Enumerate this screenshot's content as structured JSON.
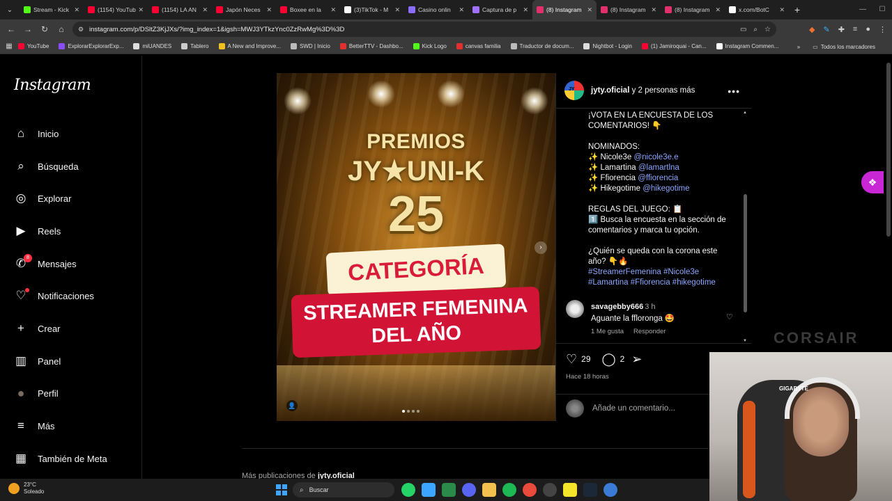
{
  "browser": {
    "tabs": [
      {
        "label": "Stream - Kick",
        "color": "#53fc18",
        "active": false
      },
      {
        "label": "(1154) YouTube",
        "color": "#ff0033",
        "active": false
      },
      {
        "label": "(1154) LA AN",
        "color": "#ff0033",
        "active": false
      },
      {
        "label": "Japón Neces",
        "color": "#ff0033",
        "active": false
      },
      {
        "label": "Boxee en la",
        "color": "#ff0033",
        "active": false
      },
      {
        "label": "(3)TikTok - M",
        "color": "#ffffff",
        "active": false
      },
      {
        "label": "Casino onlin",
        "color": "#8a6cff",
        "active": false
      },
      {
        "label": "Captura de p",
        "color": "#a070ff",
        "active": false
      },
      {
        "label": "(8) Instagram",
        "color": "#e1306c",
        "active": true
      },
      {
        "label": "(8) Instagram",
        "color": "#e1306c",
        "active": false
      },
      {
        "label": "(8) Instagram",
        "color": "#e1306c",
        "active": false
      },
      {
        "label": "x.com/BotC",
        "color": "#ffffff",
        "active": false
      }
    ],
    "url": "instagram.com/p/DSltZ3KjJXs/?img_index=1&igsh=MWJ3YTkzYnc0ZzRwMg%3D%3D",
    "bookmarks": [
      {
        "label": "YouTube",
        "color": "#ff0033"
      },
      {
        "label": "ExplorarExplorarExp...",
        "color": "#8a4cff"
      },
      {
        "label": "miUANDES",
        "color": "#dddddd"
      },
      {
        "label": "Tablero",
        "color": "#cccccc"
      },
      {
        "label": "A New and Improve...",
        "color": "#f0c020"
      },
      {
        "label": "SWD | Inicio",
        "color": "#bbbbbb"
      },
      {
        "label": "BetterTTV - Dashbo...",
        "color": "#e03030"
      },
      {
        "label": "Kick Logo",
        "color": "#53fc18"
      },
      {
        "label": "canvas familia",
        "color": "#e03030"
      },
      {
        "label": "Traductor de docum...",
        "color": "#bbbbbb"
      },
      {
        "label": "Nightbot - Login",
        "color": "#dddddd"
      },
      {
        "label": "(1) Jamiroquai - Can...",
        "color": "#ff0033"
      },
      {
        "label": "Instagram Commen...",
        "color": "#ffffff"
      }
    ],
    "all_bookmarks": "Todos los marcadores"
  },
  "instagram": {
    "logo": "Instagram",
    "nav": [
      {
        "label": "Inicio",
        "icon": "home-icon"
      },
      {
        "label": "Búsqueda",
        "icon": "search-icon"
      },
      {
        "label": "Explorar",
        "icon": "compass-icon"
      },
      {
        "label": "Reels",
        "icon": "reels-icon"
      },
      {
        "label": "Mensajes",
        "icon": "messenger-icon",
        "badge": "8"
      },
      {
        "label": "Notificaciones",
        "icon": "heart-icon"
      },
      {
        "label": "Crear",
        "icon": "plus-icon"
      },
      {
        "label": "Panel",
        "icon": "chart-icon"
      },
      {
        "label": "Perfil",
        "icon": "profile-avatar"
      },
      {
        "label": "Más",
        "icon": "menu-icon"
      },
      {
        "label": "También de Meta",
        "icon": "meta-icon"
      }
    ],
    "post": {
      "image_text": {
        "line1": "PREMIOS",
        "line2": "JY★UNI-K",
        "line3": "25",
        "category": "CATEGORÍA",
        "award_line1": "STREAMER FEMENINA",
        "award_line2": "DEL AÑO"
      },
      "author": "jyty.oficial",
      "author_suffix": " y 2 personas más",
      "avatar_text": "JY",
      "caption": {
        "p1": "¡VOTA EN LA ENCUESTA DE LOS COMENTARIOS! 👇",
        "nominados_title": "NOMINADOS:",
        "nominees": [
          {
            "name": "✨ Nicole3e ",
            "handle": "@nicole3e.e"
          },
          {
            "name": "✨ Lamartina ",
            "handle": "@lamartlna"
          },
          {
            "name": "✨ Ffiorencia ",
            "handle": "@ffiorencia"
          },
          {
            "name": "✨ Hikegotime ",
            "handle": "@hikegotime"
          }
        ],
        "rules_title": "REGLAS DEL JUEGO: 📋",
        "rules": "1️⃣ Busca la encuesta en la sección de comentarios y marca tu opción.",
        "question": "¿Quién se queda con la corona este año? 👇🔥",
        "hashtags": "#StreamerFemenina #Nicole3e #Lamartina #Ffiorencia #hikegotime"
      },
      "comment": {
        "user": "savagebby666",
        "time": "3 h",
        "text": "Aguante la fflorongа 🤩",
        "likes": "1 Me gusta",
        "reply": "Responder"
      },
      "likes": "29",
      "comments_count": "2",
      "posted": "Hace 18 horas",
      "add_comment_placeholder": "Añade un comentario..."
    },
    "more_posts_prefix": "Más publicaciones de ",
    "more_posts_user": "jyty.oficial"
  },
  "overlay": {
    "corsair": "CORSAIR",
    "cam_brand": "GIGABYTE"
  },
  "taskbar": {
    "temp": "23°C",
    "weather": "Soleado",
    "search": "Buscar"
  }
}
